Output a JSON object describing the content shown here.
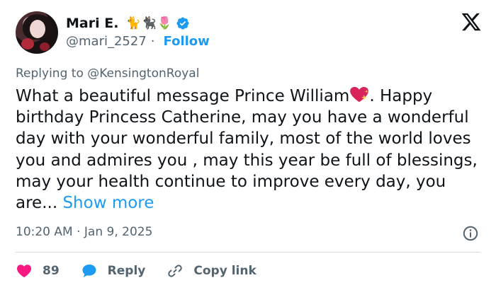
{
  "author": {
    "display_name": "Mari E.",
    "emojis": "🐈🐈‍⬛🌷",
    "handle": "@mari_2527",
    "separator": "·",
    "follow_label": "Follow",
    "verified_color": "#1d9bf0"
  },
  "reply_context": {
    "prefix": "Replying to",
    "mention": "@KensingtonRoyal"
  },
  "tweet": {
    "text_part1": "What a beautiful message Prince William",
    "text_part2": ". Happy birthday Princess Catherine, may you have a wonderful day with your wonderful family, most of the world loves you and admires you , may this year be full of blessings, may your health continue to improve every day, you are... ",
    "show_more_label": "Show more"
  },
  "meta": {
    "time": "10:20 AM",
    "separator": "·",
    "date": "Jan 9, 2025"
  },
  "actions": {
    "likes_count": "89",
    "reply_label": "Reply",
    "copy_link_label": "Copy link"
  },
  "icons": {
    "x_logo": "x-logo-icon",
    "info": "info-icon",
    "heart": "heart-icon",
    "reply": "speech-bubble-icon",
    "link": "link-icon",
    "verified": "verified-badge-icon",
    "heart_emoji": "sparkling-heart-icon"
  },
  "colors": {
    "accent": "#1d9bf0",
    "like": "#f91880",
    "muted": "#536471",
    "text": "#0f1419"
  }
}
